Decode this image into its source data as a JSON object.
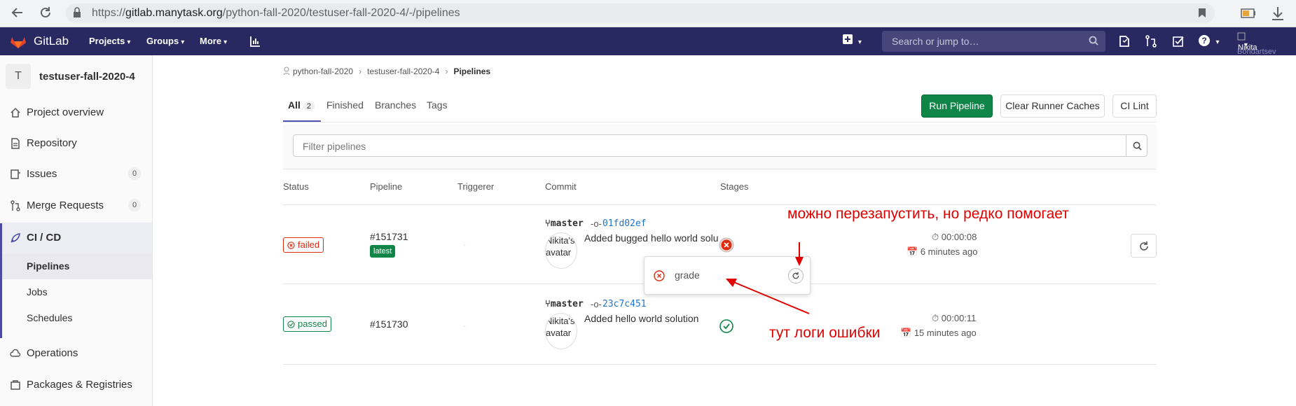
{
  "browser": {
    "url_prefix": "https://",
    "url_host": "gitlab.manytask.org",
    "url_path": "/python-fall-2020/testuser-fall-2020-4/-/pipelines"
  },
  "topnav": {
    "brand": "GitLab",
    "menus": [
      "Projects",
      "Groups",
      "More"
    ],
    "search_placeholder": "Search or jump to…",
    "user_first": "Nikita",
    "user_last": "Bondartsev"
  },
  "sidebar": {
    "project_initial": "T",
    "project_name": "testuser-fall-2020-4",
    "items": [
      {
        "label": "Project overview",
        "badge": ""
      },
      {
        "label": "Repository",
        "badge": ""
      },
      {
        "label": "Issues",
        "badge": "0"
      },
      {
        "label": "Merge Requests",
        "badge": "0"
      },
      {
        "label": "CI / CD",
        "badge": ""
      },
      {
        "label": "Operations",
        "badge": ""
      },
      {
        "label": "Packages & Registries",
        "badge": ""
      }
    ],
    "subitems": [
      "Pipelines",
      "Jobs",
      "Schedules"
    ]
  },
  "breadcrumb": {
    "group": "python-fall-2020",
    "project": "testuser-fall-2020-4",
    "current": "Pipelines"
  },
  "tabs": {
    "all": "All",
    "all_count": "2",
    "finished": "Finished",
    "branches": "Branches",
    "tags": "Tags"
  },
  "buttons": {
    "run_pipeline": "Run Pipeline",
    "clear_caches": "Clear Runner Caches",
    "ci_lint": "CI Lint"
  },
  "filter": {
    "placeholder": "Filter pipelines"
  },
  "table": {
    "headers": [
      "Status",
      "Pipeline",
      "Triggerer",
      "Commit",
      "Stages"
    ],
    "rows": [
      {
        "status": "failed",
        "pipeline": "#151731",
        "tag": "latest",
        "triggerer": "-",
        "branch": "master",
        "sha": "01fd02ef",
        "avatar_alt": "Nikita's avatar",
        "message": "Added bugged hello world solu",
        "duration": "00:00:08",
        "ago": "6 minutes ago"
      },
      {
        "status": "passed",
        "pipeline": "#151730",
        "tag": "",
        "triggerer": "-",
        "branch": "master",
        "sha": "23c7c451",
        "avatar_alt": "Nikita's avatar",
        "message": "Added hello world solution",
        "duration": "00:00:11",
        "ago": "15 minutes ago"
      }
    ]
  },
  "popover": {
    "job_name": "grade"
  },
  "annotations": {
    "top": "можно перезапустить, но редко помогает",
    "bottom": "тут логи ошибки"
  },
  "colors": {
    "topnav": "#292961",
    "failed": "#dd2b0e",
    "passed": "#108548",
    "annotation": "#e00000"
  }
}
